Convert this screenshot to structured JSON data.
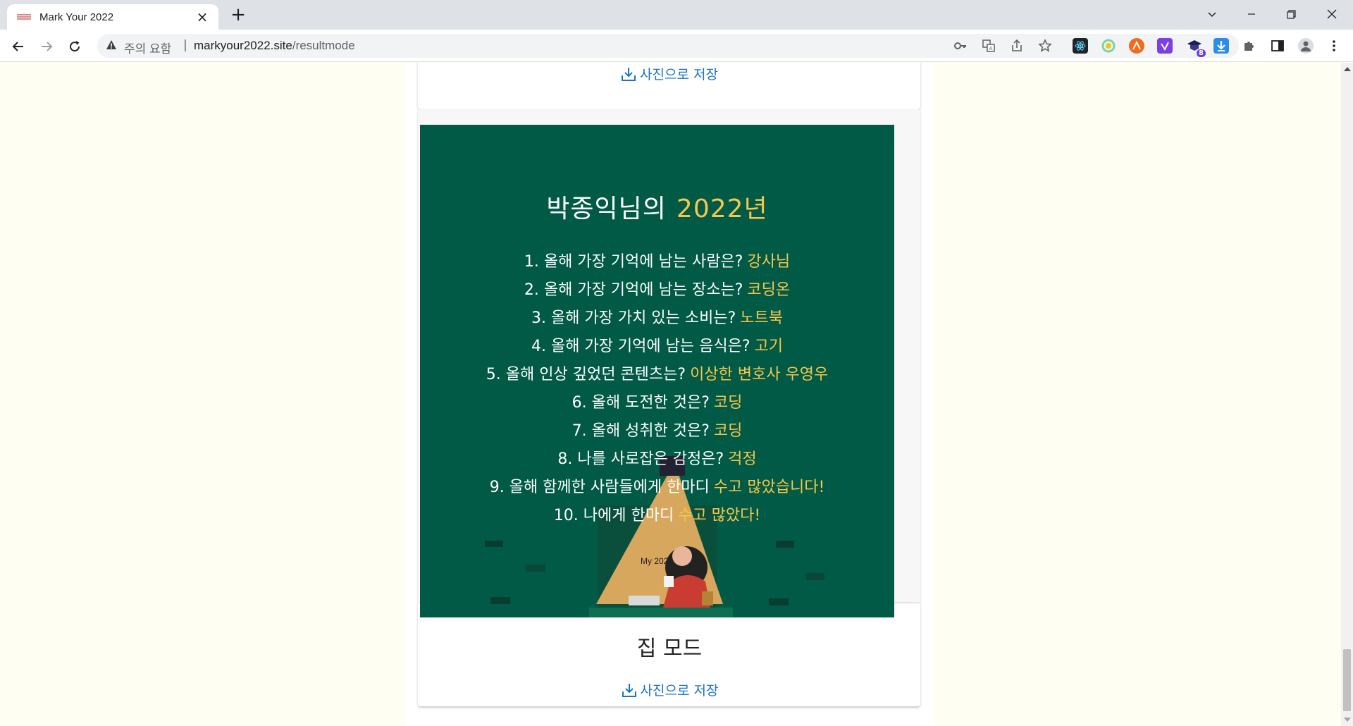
{
  "browser": {
    "tab_title": "Mark Your 2022",
    "tab_close": "×",
    "new_tab": "+",
    "security_label": "주의 요함",
    "security_separator": "|",
    "url_host": "markyour2022.site",
    "url_path": "/resultmode",
    "extension_badge": "8"
  },
  "page": {
    "save_label": "사진으로 저장",
    "mode_title": "집 모드",
    "board": {
      "name": "박종익님의",
      "year": "2022년",
      "scene_label": "My 2022",
      "items": [
        {
          "q": "1. 올해 가장 기억에 남는 사람은?",
          "a": "강사님"
        },
        {
          "q": "2. 올해 가장 기억에 남는 장소는?",
          "a": "코딩온"
        },
        {
          "q": "3. 올해 가장 가치 있는 소비는?",
          "a": "노트북"
        },
        {
          "q": "4. 올해 가장 기억에 남는 음식은?",
          "a": "고기"
        },
        {
          "q": "5. 올해 인상 깊었던 콘텐츠는?",
          "a": "이상한 변호사 우영우"
        },
        {
          "q": "6. 올해 도전한 것은?",
          "a": "코딩"
        },
        {
          "q": "7. 올해 성취한 것은?",
          "a": "코딩"
        },
        {
          "q": "8. 나를 사로잡은 감정은?",
          "a": "걱정"
        },
        {
          "q": "9. 올해 함께한 사람들에게 한마디",
          "a": "수고 많았습니다!"
        },
        {
          "q": "10. 나에게 한마디",
          "a": "수고 많았다!"
        }
      ]
    }
  },
  "colors": {
    "board_bg": "#015a45",
    "highlight": "#f7c64b",
    "link": "#1a73c8",
    "page_bg": "#fffef2"
  }
}
